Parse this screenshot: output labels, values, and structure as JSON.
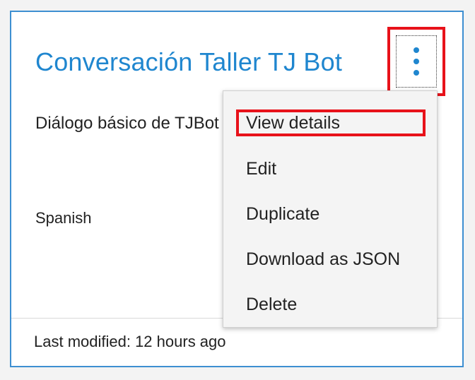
{
  "card": {
    "title": "Conversación Taller TJ Bot",
    "description": "Diálogo básico de TJBot",
    "language": "Spanish",
    "last_modified": "Last modified: 12 hours ago"
  },
  "overflow_button": {
    "icon": "kebab-vertical-icon"
  },
  "menu": {
    "items": [
      {
        "label": "View details"
      },
      {
        "label": "Edit"
      },
      {
        "label": "Duplicate"
      },
      {
        "label": "Download as JSON"
      },
      {
        "label": "Delete"
      }
    ]
  },
  "colors": {
    "accent": "#1f86cf",
    "card_border": "#3d8fd1",
    "highlight": "#e8121a"
  }
}
